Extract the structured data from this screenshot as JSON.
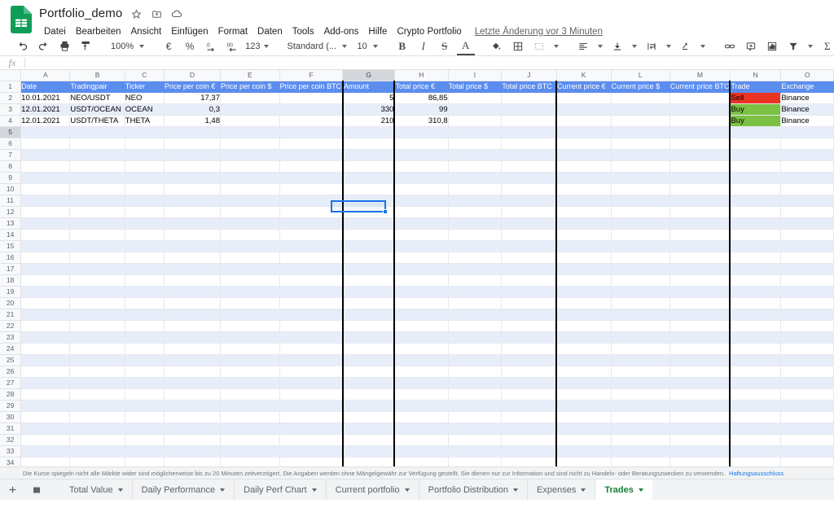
{
  "app": {
    "logo_icon": "google-sheets-icon",
    "doc_title": "Portfolio_demo",
    "title_icons": [
      {
        "name": "star-icon",
        "glyph": "☆"
      },
      {
        "name": "move-to-folder-icon",
        "glyph": "⧉"
      },
      {
        "name": "cloud-saved-icon",
        "glyph": "☁"
      }
    ],
    "menus": [
      {
        "label": "Datei"
      },
      {
        "label": "Bearbeiten"
      },
      {
        "label": "Ansicht"
      },
      {
        "label": "Einfügen"
      },
      {
        "label": "Format"
      },
      {
        "label": "Daten"
      },
      {
        "label": "Tools"
      },
      {
        "label": "Add-ons"
      },
      {
        "label": "Hilfe"
      },
      {
        "label": "Crypto Portfolio"
      }
    ],
    "last_edit": "Letzte Änderung vor 3 Minuten"
  },
  "toolbar": {
    "undo_icon": "undo-icon",
    "redo_icon": "redo-icon",
    "print_icon": "print-icon",
    "paint_format_icon": "paint-format-icon",
    "zoom_value": "100%",
    "currency_icon": "euro-currency-icon",
    "percent_icon": "percent-format-icon",
    "decrease_decimal_icon": "decrease-decimal-icon",
    "increase_decimal_icon": "increase-decimal-icon",
    "more_formats_label": "123",
    "font_value": "Standard (...",
    "font_size_value": "10",
    "bold_label": "B",
    "italic_label": "I",
    "strikethrough_label": "S",
    "text_color_label": "A",
    "fill_color_icon": "fill-color-icon",
    "borders_icon": "borders-icon",
    "merge_cells_icon": "merge-cells-icon",
    "halign_icon": "horizontal-align-icon",
    "valign_icon": "vertical-align-icon",
    "text_wrap_icon": "text-wrapping-icon",
    "text_rotation_icon": "text-rotation-icon",
    "link_icon": "insert-link-icon",
    "comment_icon": "insert-comment-icon",
    "chart_icon": "insert-chart-icon",
    "filter_icon": "filter-icon",
    "functions_icon": "functions-sigma-icon"
  },
  "formula_bar": {
    "fx_label": "fx",
    "value": ""
  },
  "grid": {
    "selected_cell": "G5",
    "columns": [
      "A",
      "B",
      "C",
      "D",
      "E",
      "F",
      "G",
      "H",
      "I",
      "J",
      "K",
      "L",
      "M",
      "N",
      "O"
    ],
    "row_numbers": [
      1,
      2,
      3,
      4,
      5,
      6,
      7,
      8,
      9,
      10,
      11,
      12,
      13,
      14,
      15,
      16,
      17,
      18,
      19,
      20,
      21,
      22,
      23,
      24,
      25,
      26,
      27,
      28,
      29,
      30,
      31,
      32,
      33,
      34
    ],
    "headers": [
      "Date",
      "Tradingpair",
      "Ticker",
      "Price per coin €",
      "Price per coin $",
      "Price per coin BTC",
      "Amount",
      "Total price €",
      "Total price $",
      "Total price BTC",
      "Current price €",
      "Current price $",
      "Current price BTC",
      "Trade",
      "Exchange"
    ],
    "rows": [
      {
        "date": "10.01.2021",
        "pair": "NEO/USDT",
        "ticker": "NEO",
        "price_eur": "17,37",
        "price_usd": "",
        "price_btc": "",
        "amount": "5",
        "total_eur": "86,85",
        "total_usd": "",
        "total_btc": "",
        "cur_eur": "",
        "cur_usd": "",
        "cur_btc": "",
        "trade": "Sell",
        "exchange": "Binance"
      },
      {
        "date": "12.01.2021",
        "pair": "USDT/OCEAN",
        "ticker": "OCEAN",
        "price_eur": "0,3",
        "price_usd": "",
        "price_btc": "",
        "amount": "330",
        "total_eur": "99",
        "total_usd": "",
        "total_btc": "",
        "cur_eur": "",
        "cur_usd": "",
        "cur_btc": "",
        "trade": "Buy",
        "exchange": "Binance"
      },
      {
        "date": "12.01.2021",
        "pair": "USDT/THETA",
        "ticker": "THETA",
        "price_eur": "1,48",
        "price_usd": "",
        "price_btc": "",
        "amount": "210",
        "total_eur": "310,8",
        "total_usd": "",
        "total_btc": "",
        "cur_eur": "",
        "cur_usd": "",
        "cur_btc": "",
        "trade": "Buy",
        "exchange": "Binance"
      }
    ],
    "colors": {
      "header_fill": "#5b8def",
      "banding_fill": "#e8edfa",
      "sell_fill": "#ea3323",
      "buy_fill": "#7cc144",
      "selection_border": "#1a73e8"
    }
  },
  "disclaimer": {
    "text": "Die Kurse spiegeln nicht alle Märkte wider sind möglicherweise bis zu 20 Minuten zeitverzögert. Die Angaben werden ohne Mängelgewähr zur Verfügung gestellt. Sie dienen nur zur Information und sind nicht zu Handels- oder Beratungszwecken zu verwenden.",
    "link_label": "Haftungsausschluss"
  },
  "sheet_tabs": {
    "add_sheet_icon": "add-sheet-icon",
    "all_sheets_icon": "all-sheets-icon",
    "tabs": [
      {
        "label": "Total Value",
        "active": false
      },
      {
        "label": "Daily Performance",
        "active": false
      },
      {
        "label": "Daily Perf Chart",
        "active": false
      },
      {
        "label": "Current portfolio",
        "active": false
      },
      {
        "label": "Portfolio Distribution",
        "active": false
      },
      {
        "label": "Expenses",
        "active": false
      },
      {
        "label": "Trades",
        "active": true
      }
    ]
  }
}
